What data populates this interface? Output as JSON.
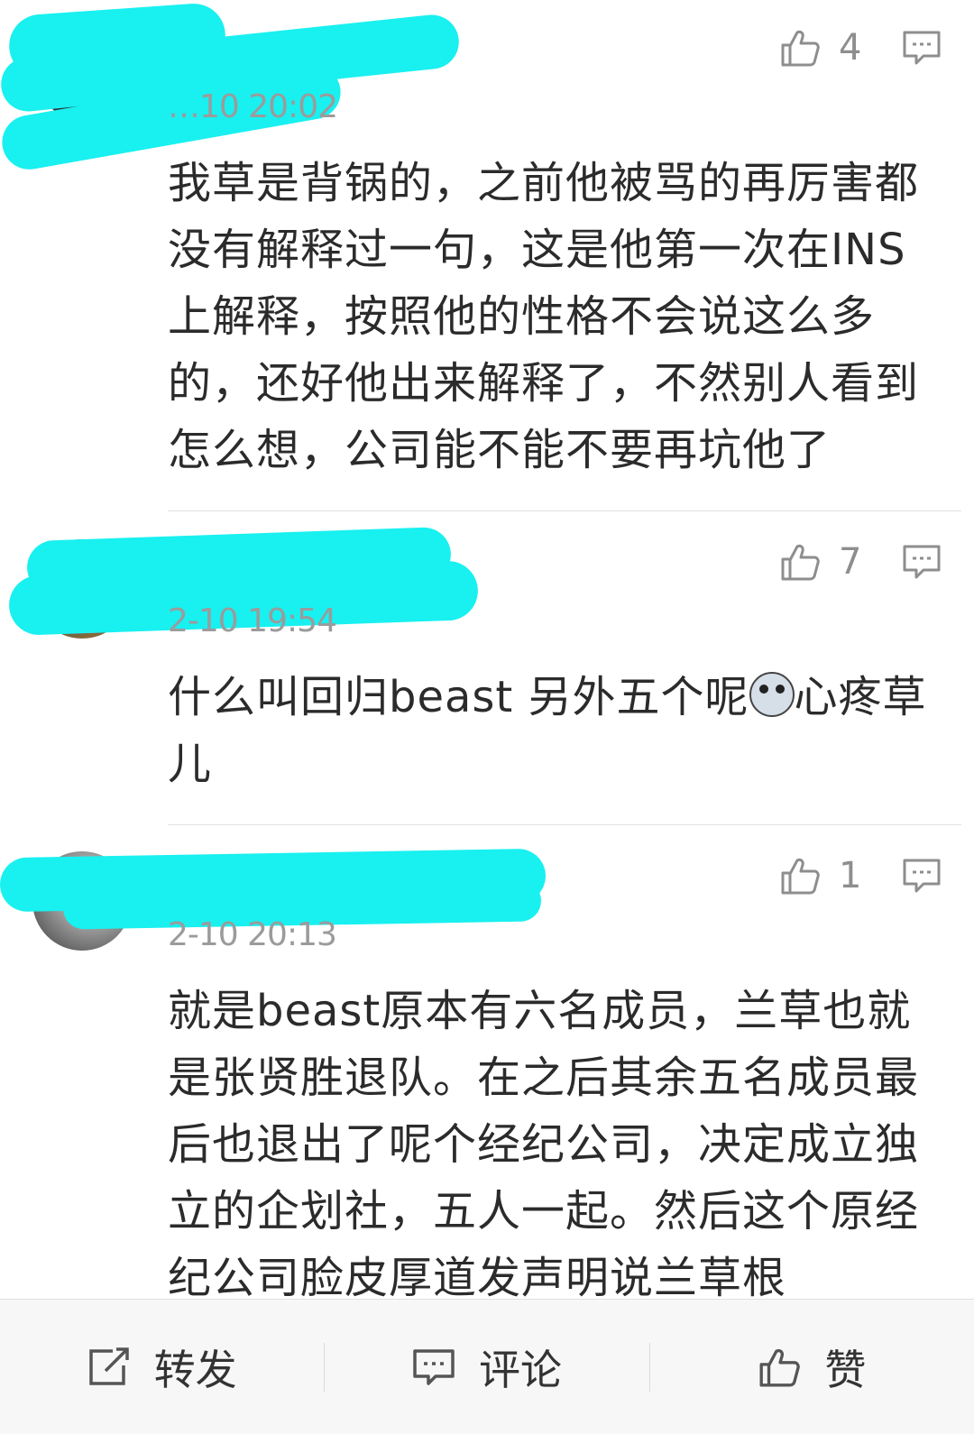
{
  "comments": [
    {
      "timestamp": "…10 20:02",
      "likes": "4",
      "text": "我草是背锅的，之前他被骂的再厉害都没有解释过一句，这是他第一次在INS上解释，按照他的性格不会说这么多的，还好他出来解释了，不然别人看到怎么想，公司能不能不要再坑他了"
    },
    {
      "timestamp": "2-10 19:54",
      "likes": "7",
      "text_before_emoji": "什么叫回归beast 另外五个呢",
      "emoji": "surprised-dog-emoji",
      "text_after_emoji": "心疼草儿"
    },
    {
      "timestamp": "2-10 20:13",
      "likes": "1",
      "text": "就是beast原本有六名成员，兰草也就是张贤胜退队。在之后其余五名成员最后也退出了呢个经纪公司，决定成立独立的企划社，五人一起。然后这个原经纪公司脸皮厚道发声明说兰草根"
    }
  ],
  "bottom_bar": {
    "repost_label": "转发",
    "comment_label": "评论",
    "like_label": "赞"
  },
  "colors": {
    "redaction": "#19f0f0",
    "muted_text": "#9b9b9b",
    "body_text": "#2b2b2b"
  }
}
